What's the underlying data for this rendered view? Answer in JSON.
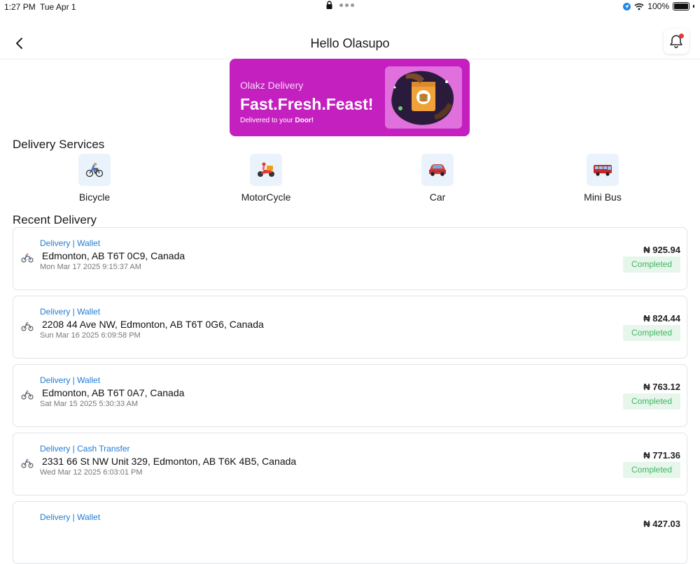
{
  "status_bar": {
    "time": "1:27 PM",
    "date": "Tue Apr 1",
    "battery": "100%"
  },
  "header": {
    "title": "Hello Olasupo"
  },
  "banner": {
    "brand": "Olakz Delivery",
    "tagline": "Fast.Fresh.Feast!",
    "subtitle_prefix": "Delivered to your ",
    "subtitle_emphasis": "Door!",
    "bg_color": "#c41fbf"
  },
  "services": {
    "title": "Delivery Services",
    "items": [
      {
        "label": "Bicycle",
        "icon": "bicycle-icon"
      },
      {
        "label": "MotorCycle",
        "icon": "motorcycle-icon"
      },
      {
        "label": "Car",
        "icon": "car-icon"
      },
      {
        "label": "Mini Bus",
        "icon": "minibus-icon"
      }
    ]
  },
  "recent": {
    "title": "Recent Delivery",
    "items": [
      {
        "method": "Delivery | Wallet",
        "address": "Edmonton, AB T6T 0C9, Canada",
        "date": "Mon Mar 17 2025 9:15:37 AM",
        "amount": "₦ 925.94",
        "status": "Completed"
      },
      {
        "method": "Delivery | Wallet",
        "address": "2208 44 Ave NW, Edmonton, AB T6T 0G6, Canada",
        "date": "Sun Mar 16 2025 6:09:58 PM",
        "amount": "₦ 824.44",
        "status": "Completed"
      },
      {
        "method": "Delivery | Wallet",
        "address": "Edmonton, AB T6T 0A7, Canada",
        "date": "Sat Mar 15 2025 5:30:33 AM",
        "amount": "₦ 763.12",
        "status": "Completed"
      },
      {
        "method": "Delivery | Cash Transfer",
        "address": "2331 66 St NW Unit 329, Edmonton, AB T6K 4B5, Canada",
        "date": "Wed Mar 12 2025 6:03:01 PM",
        "amount": "₦ 771.36",
        "status": "Completed"
      },
      {
        "method": "Delivery | Wallet",
        "address": "",
        "date": "",
        "amount": "₦ 427.03",
        "status": ""
      }
    ]
  },
  "colors": {
    "link": "#1e7bd6",
    "completed_text": "#41b565",
    "completed_bg": "#e6f6ea",
    "notification_dot": "#e53935"
  }
}
